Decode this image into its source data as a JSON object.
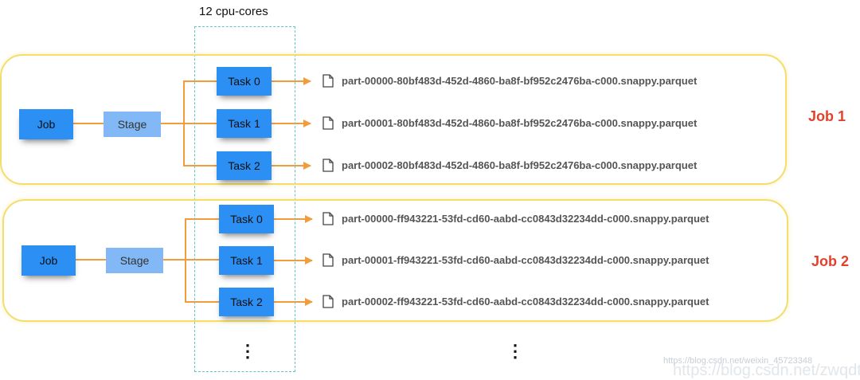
{
  "cpu_cores_label": "12 cpu-cores",
  "colors": {
    "box": "#2b8ff3",
    "stage": "#81b8f5",
    "arrow": "#f39c3c",
    "frame": "#f3dd6d",
    "cores": "#5fc6c4",
    "job_label": "#e2412c"
  },
  "jobs": [
    {
      "label": "Job 1",
      "job_box": "Job",
      "stage_box": "Stage",
      "tasks": [
        {
          "label": "Task 0",
          "file": "part-00000-80bf483d-452d-4860-ba8f-bf952c2476ba-c000.snappy.parquet"
        },
        {
          "label": "Task 1",
          "file": "part-00001-80bf483d-452d-4860-ba8f-bf952c2476ba-c000.snappy.parquet"
        },
        {
          "label": "Task 2",
          "file": "part-00002-80bf483d-452d-4860-ba8f-bf952c2476ba-c000.snappy.parquet"
        }
      ]
    },
    {
      "label": "Job 2",
      "job_box": "Job",
      "stage_box": "Stage",
      "tasks": [
        {
          "label": "Task 0",
          "file": "part-00000-ff943221-53fd-cd60-aabd-cc0843d32234dd-c000.snappy.parquet"
        },
        {
          "label": "Task 1",
          "file": "part-00001-ff943221-53fd-cd60-aabd-cc0843d32234dd-c000.snappy.parquet"
        },
        {
          "label": "Task 2",
          "file": "part-00002-ff943221-53fd-cd60-aabd-cc0843d32234dd-c000.snappy.parquet"
        }
      ]
    }
  ],
  "ellipsis": "⋮",
  "watermark_small": "https://blog.csdn.net/weixin_45723348",
  "watermark_large": "https://blog.csdn.net/zwqdt"
}
